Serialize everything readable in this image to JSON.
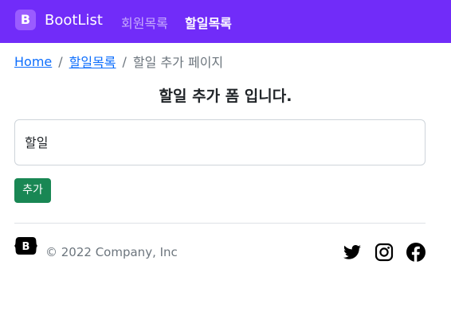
{
  "navbar": {
    "brand_logo_letter": "B",
    "brand_name": "BootList",
    "links": [
      {
        "label": "회원목록",
        "active": false
      },
      {
        "label": "할일목록",
        "active": true
      }
    ],
    "background_color": "#712cf9"
  },
  "breadcrumb": {
    "items": [
      "Home",
      "할일목록"
    ],
    "separator": "/",
    "current": "할일 추가 페이지"
  },
  "form": {
    "title": "할일 추가 폼 입니다.",
    "input_placeholder": "할일",
    "submit_label": "추가",
    "submit_color": "#198754"
  },
  "footer": {
    "logo_letter": "B",
    "copyright": "© 2022 Company, Inc",
    "social_icons": [
      "twitter-icon",
      "instagram-icon",
      "facebook-icon"
    ]
  }
}
